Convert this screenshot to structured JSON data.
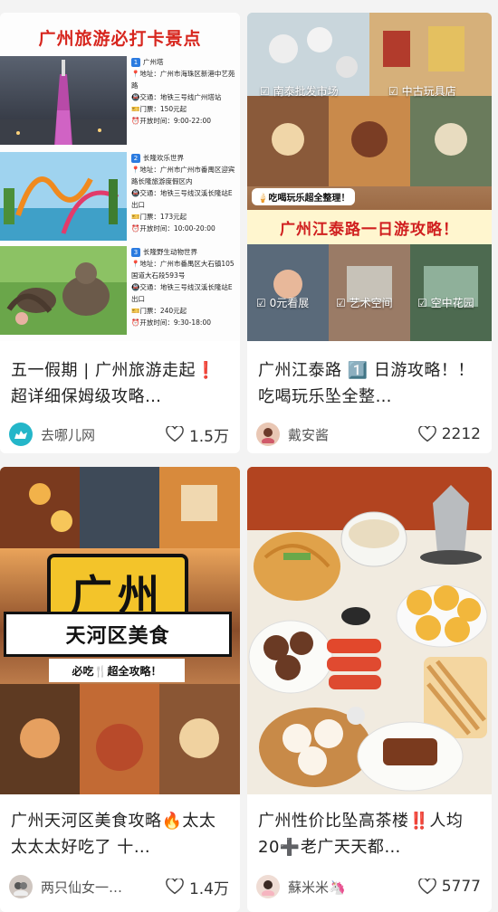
{
  "cards": [
    {
      "title": "五一假期 | 广州旅游走起❗️超详细保姆级攻略…",
      "author": "去哪儿网",
      "likes": "1.5万",
      "cover": {
        "heading": "广州旅游必打卡景点",
        "spots": [
          {
            "num": "1",
            "name": "广州塔",
            "address": "📍地址：广州市海珠区新港中艺苑路",
            "transit": "🚇交通：地铁三号线广州塔站",
            "ticket": "🎫门票：150元起",
            "hours": "⏰开放时间：9:00-22:00"
          },
          {
            "num": "2",
            "name": "长隆欢乐世界",
            "address": "📍地址：广州市广州市番禺区迎宾路长隆旅游度假区内",
            "transit": "🚇交通：地铁三号线汉溪长隆站E出口",
            "ticket": "🎫门票：173元起",
            "hours": "⏰开放时间：10:00-20:00"
          },
          {
            "num": "3",
            "name": "长隆野生动物世界",
            "address": "📍地址：广州市番禺区大石镇105国道大石段593号",
            "transit": "🚇交通：地铁三号线汉溪长隆站E出口",
            "ticket": "🎫门票：240元起",
            "hours": "⏰开放时间：9:30-18:00"
          }
        ]
      }
    },
    {
      "title": "广州江泰路 1️⃣ 日游攻略！！吃喝玩乐坠全整…",
      "author": "戴安酱",
      "likes": "2212",
      "cover": {
        "tag1": "☑ 南泰批发市场",
        "tag2": "☑ 中古玩具店",
        "sub": "🍦吃喝玩乐超全整理！",
        "band": "广州江泰路一日游攻略！",
        "tag3": "☑ 0元看展",
        "tag4": "☑ 艺术空间",
        "tag5": "☑ 空中花园"
      }
    },
    {
      "title": "广州天河区美食攻略🔥太太太太太好吃了 十…",
      "author": "两只仙女一…",
      "likes": "1.4万",
      "cover": {
        "big": "广州",
        "sub1": "天河区美食",
        "sub2": "必吃🍴超全攻略！"
      }
    },
    {
      "title": "广州性价比坠高茶楼‼️人均20➕老广天天都…",
      "author": "蘇米米🦄",
      "likes": "5777",
      "cover": {}
    }
  ],
  "icons": {
    "like": "heart-outline-icon"
  },
  "colors": {
    "accent_red": "#d7261e",
    "band_bg": "#fff6cf",
    "tag_blue": "#2b7be0"
  }
}
